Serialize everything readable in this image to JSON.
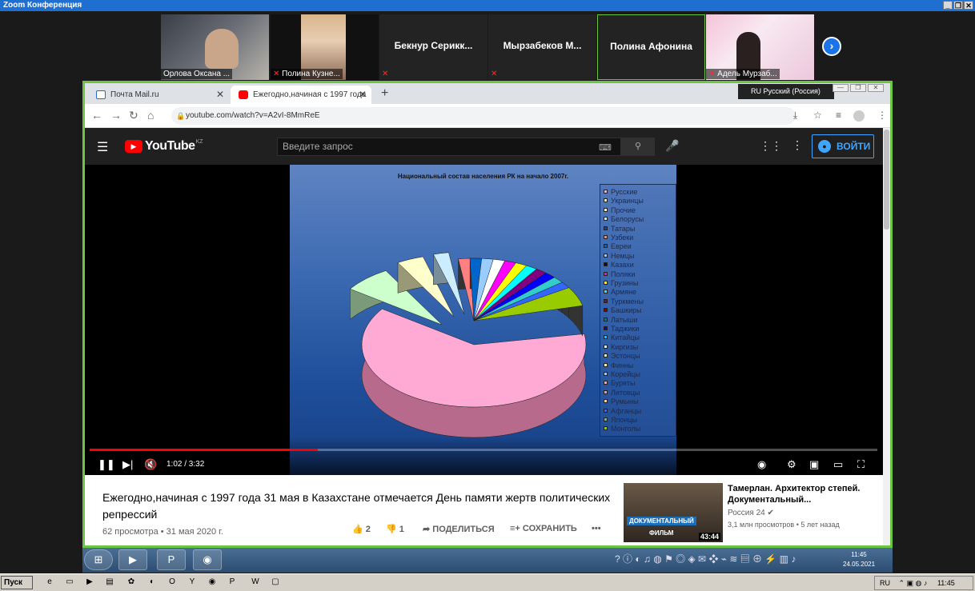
{
  "zoom": {
    "title": "Zoom Конференция",
    "controls": [
      "_",
      "❐",
      "✕"
    ]
  },
  "participants": [
    {
      "name": "Орлова Оксана ...",
      "type": "video",
      "muted": false
    },
    {
      "name": "Полина Кузне...",
      "type": "video",
      "muted": true
    },
    {
      "name": "Бекнур  Серикк...",
      "type": "name",
      "muted": true
    },
    {
      "name": "Мырзабеков  М...",
      "type": "name",
      "muted": true
    },
    {
      "name": "Полина Афонина",
      "type": "name",
      "muted": false,
      "active": true
    },
    {
      "name": "Адель Мурзаб...",
      "type": "video",
      "muted": true
    }
  ],
  "browser": {
    "tabs": [
      {
        "label": "Почта Mail.ru",
        "active": false
      },
      {
        "label": "Ежегодно,начиная с 1997 года",
        "active": true
      }
    ],
    "language": "RU Русский (Россия)",
    "url": "youtube.com/watch?v=A2vI-8MmReE"
  },
  "youtube": {
    "logo": "YouTube",
    "region": "KZ",
    "search_placeholder": "Введите запрос",
    "signin_label": "ВОЙТИ"
  },
  "player": {
    "time": "1:02 / 3:32",
    "progress": 0.29
  },
  "slide": {
    "title": "Национальный состав населения РК на начало 2007г.",
    "legend": [
      "Русские",
      "Украинцы",
      "Прочие",
      "Белорусы",
      "Татары",
      "Узбеки",
      "Евреи",
      "Немцы",
      "Казахи",
      "Поляки",
      "Грузины",
      "Армяне",
      "Туркмены",
      "Башкиры",
      "Латыши",
      "Таджики",
      "Китайцы",
      "Киргизы",
      "Эстонцы",
      "Финны",
      "Корейцы",
      "Буряты",
      "Литовцы",
      "Румыны",
      "Афганцы",
      "Японцы",
      "Монголы"
    ],
    "colors": [
      "#ffaad4",
      "#ccffcc",
      "#ffffcc",
      "#ccecff",
      "#1f3f9f",
      "#ff8080",
      "#0066cc",
      "#99ccff",
      "#000080",
      "#ff00ff",
      "#ffff00",
      "#00ffff",
      "#800080",
      "#800000",
      "#008080",
      "#0000ff",
      "#00ccff",
      "#ccffff",
      "#ccffcc",
      "#ffff99",
      "#99ccff",
      "#ff99cc",
      "#cc99ff",
      "#ffcc99",
      "#3366ff",
      "#33cccc",
      "#99cc00"
    ]
  },
  "video": {
    "title": "Ежегодно,начиная с 1997 года 31 мая в Казахстане отмечается День памяти жертв политических репрессий",
    "meta": "62 просмотра • 31 мая 2020 г.",
    "likes": "2",
    "dislikes": "1",
    "share_label": "ПОДЕЛИТЬСЯ",
    "save_label": "СОХРАНИТЬ"
  },
  "recommended": {
    "title": "Тамерлан. Архитектор степей. Документальный...",
    "channel": "Россия 24",
    "views": "3,1 млн просмотров • 5 лет назад",
    "badge1": "ДОКУМЕНТАЛЬНЫЙ",
    "badge2": "ФИЛЬМ",
    "duration": "43:44"
  },
  "taskbar_inner": {
    "time": "11:45",
    "date": "24.05.2021"
  },
  "windows": {
    "start_label": "Пуск",
    "lang": "RU",
    "time": "11:45"
  }
}
